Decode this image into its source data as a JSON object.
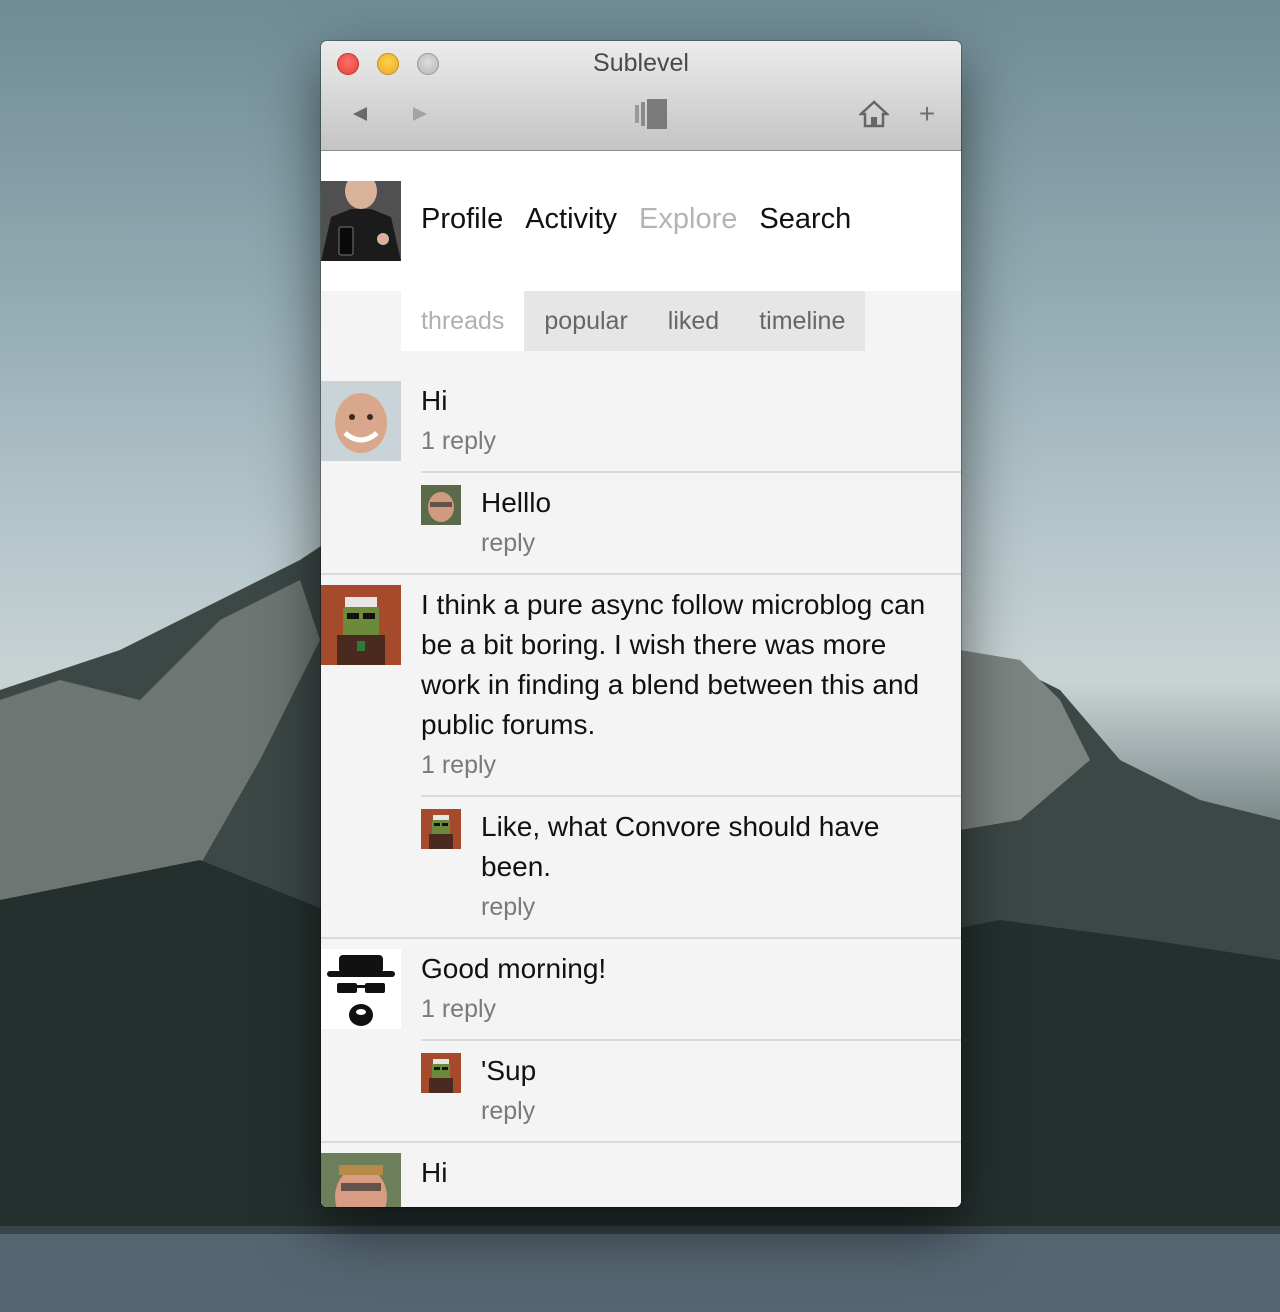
{
  "window": {
    "title": "Sublevel"
  },
  "toolbar": {
    "back_icon": "back-arrow-icon",
    "forward_icon": "forward-arrow-icon",
    "center_icon": "stack-icon",
    "home_icon": "home-icon",
    "add_label": "+"
  },
  "nav": {
    "profile": "Profile",
    "activity": "Activity",
    "explore": "Explore",
    "search": "Search"
  },
  "tabs": {
    "threads": "threads",
    "popular": "popular",
    "liked": "liked",
    "timeline": "timeline"
  },
  "threads": [
    {
      "text": "Hi",
      "meta": "1 reply",
      "reply": {
        "text": "Helllo",
        "meta": "reply"
      }
    },
    {
      "text": "I think a pure async follow microblog can be a bit boring. I wish there was more work in finding a blend between this and public forums.",
      "meta": "1 reply",
      "reply": {
        "text": "Like, what Convore should have been.",
        "meta": "reply"
      }
    },
    {
      "text": "Good morning!",
      "meta": "1 reply",
      "reply": {
        "text": "'Sup",
        "meta": "reply"
      }
    },
    {
      "text": "Hi",
      "meta": ""
    }
  ],
  "colors": {
    "accent_inactive": "#b4b4b4",
    "close": "#e0443b",
    "minimize": "#e9a829"
  }
}
